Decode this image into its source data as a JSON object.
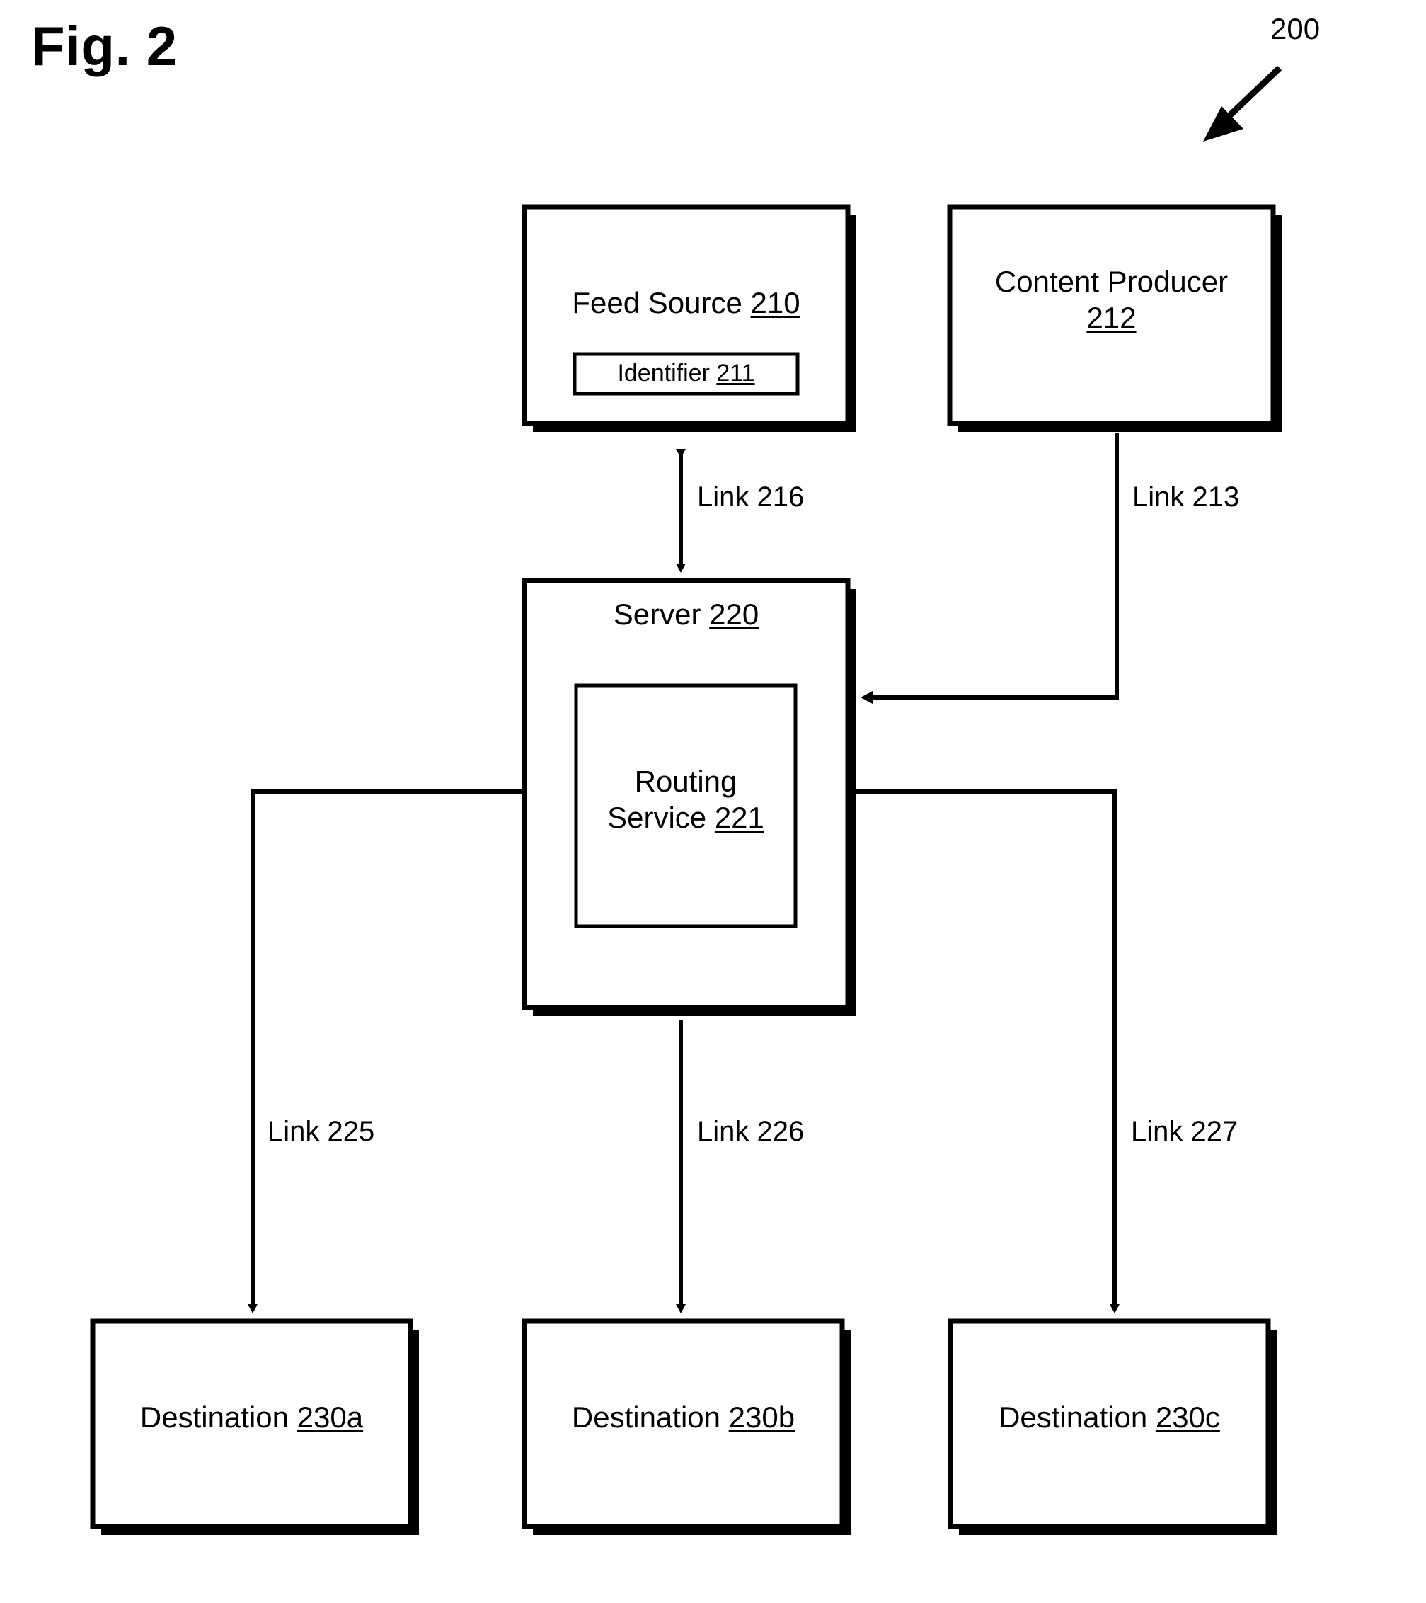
{
  "figure": {
    "title": "Fig. 2",
    "reference_numeral": "200"
  },
  "nodes": {
    "feed_source": {
      "name": "Feed Source",
      "numeral": "210",
      "inner": {
        "name": "Identifier",
        "numeral": "211"
      }
    },
    "content_producer": {
      "name": "Content Producer",
      "numeral": "212"
    },
    "server": {
      "name": "Server",
      "numeral": "220",
      "inner": {
        "name_line1": "Routing",
        "name_line2": "Service",
        "numeral": "221"
      }
    },
    "destination_a": {
      "name": "Destination",
      "numeral": "230a"
    },
    "destination_b": {
      "name": "Destination",
      "numeral": "230b"
    },
    "destination_c": {
      "name": "Destination",
      "numeral": "230c"
    }
  },
  "links": {
    "feed_to_server": {
      "label": "Link 216",
      "direction": "bidirectional",
      "from": "Feed Source 210",
      "to": "Server 220"
    },
    "producer_to_server": {
      "label": "Link 213",
      "direction": "to-server",
      "from": "Content Producer 212",
      "to": "Server 220"
    },
    "server_to_dest_a": {
      "label": "Link 225",
      "direction": "down",
      "from": "Server 220",
      "to": "Destination 230a"
    },
    "server_to_dest_b": {
      "label": "Link 226",
      "direction": "down",
      "from": "Server 220",
      "to": "Destination 230b"
    },
    "server_to_dest_c": {
      "label": "Link 227",
      "direction": "down",
      "from": "Server 220",
      "to": "Destination 230c"
    }
  },
  "style": {
    "ink": "#000000",
    "paper": "#ffffff"
  }
}
